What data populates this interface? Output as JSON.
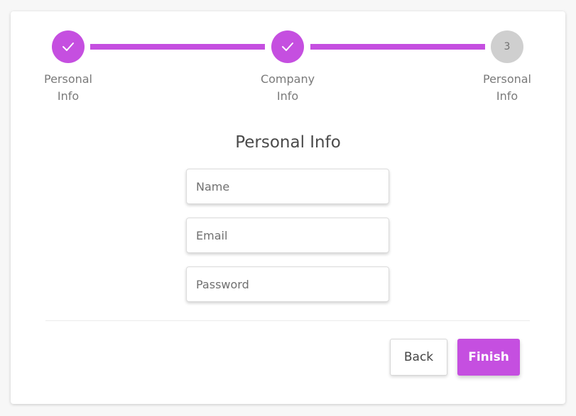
{
  "colors": {
    "accent": "#c54fe0",
    "pending": "#cfcfcf"
  },
  "stepper": {
    "steps": [
      {
        "label_line1": "Personal",
        "label_line2": "Info",
        "state": "complete",
        "icon": "check-icon"
      },
      {
        "label_line1": "Company",
        "label_line2": "Info",
        "state": "complete",
        "icon": "check-icon"
      },
      {
        "label_line1": "Personal",
        "label_line2": "Info",
        "state": "pending",
        "number": "3"
      }
    ]
  },
  "form": {
    "title": "Personal Info",
    "fields": [
      {
        "placeholder": "Name",
        "value": ""
      },
      {
        "placeholder": "Email",
        "value": ""
      },
      {
        "placeholder": "Password",
        "value": ""
      }
    ]
  },
  "actions": {
    "back_label": "Back",
    "finish_label": "Finish"
  }
}
